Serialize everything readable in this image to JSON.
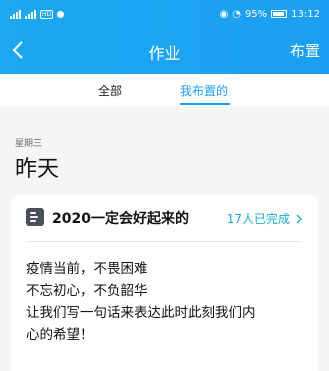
{
  "status_bar": {
    "battery": "95%",
    "time": "13:12",
    "hd_badge": "HD",
    "signal_labels": [
      "4G",
      "4G"
    ]
  },
  "navbar": {
    "title": "作业",
    "action_label": "布置"
  },
  "tabs": [
    {
      "label": "全部",
      "active": false
    },
    {
      "label": "我布置的",
      "active": true
    }
  ],
  "section": {
    "weekday": "星期三",
    "day": "昨天"
  },
  "card": {
    "title": "2020一定会好起来的",
    "completed": "17人已完成",
    "body_lines": [
      "疫情当前，不畏困难",
      "不忘初心，不负韶华",
      "让我们写一句话来表达此时此刻我们内",
      "心的希望！"
    ]
  },
  "colors": {
    "header": "#1c9ff2",
    "accent": "#1c9ff2",
    "completed": "#1caec6"
  }
}
